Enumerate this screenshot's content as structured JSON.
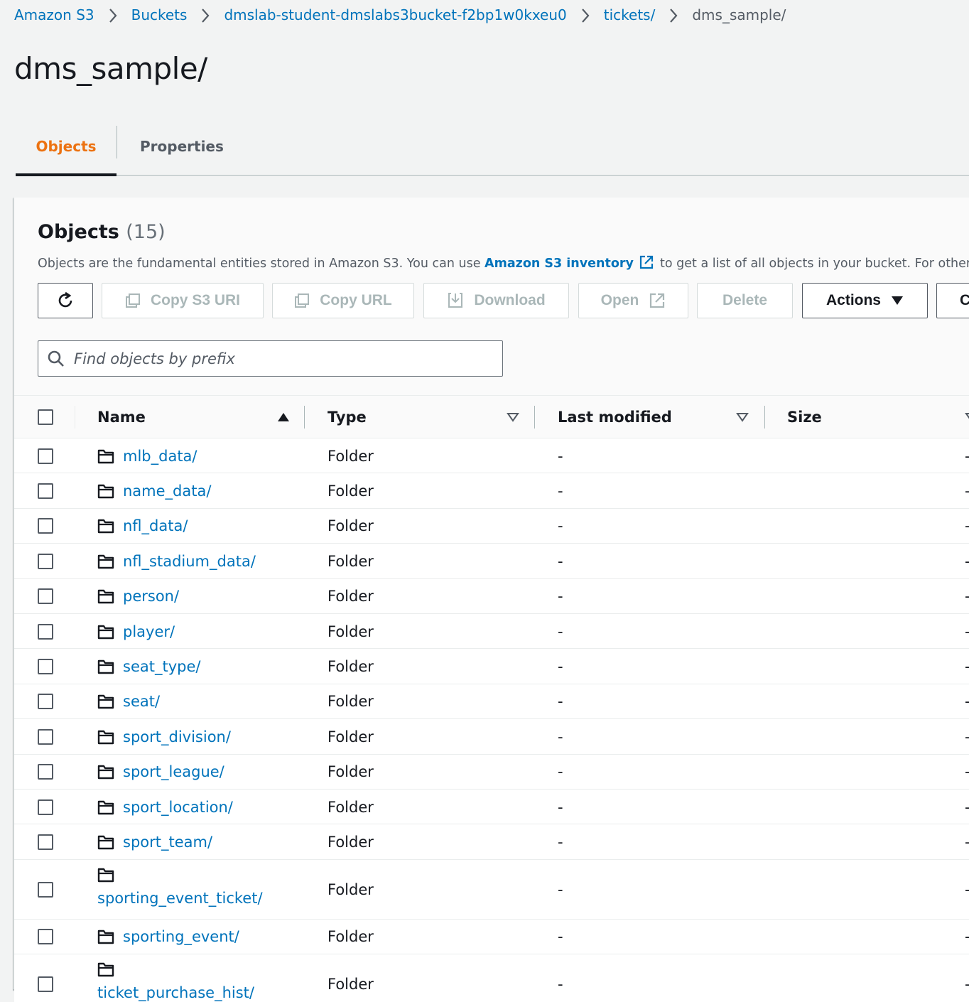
{
  "breadcrumb": [
    {
      "label": "Amazon S3"
    },
    {
      "label": "Buckets"
    },
    {
      "label": "dmslab-student-dmslabs3bucket-f2bp1w0kxeu0"
    },
    {
      "label": "tickets/"
    },
    {
      "label": "dms_sample/"
    }
  ],
  "page_title": "dms_sample/",
  "tabs": {
    "objects": "Objects",
    "properties": "Properties"
  },
  "panel": {
    "title": "Objects",
    "count": "(15)",
    "desc_before": "Objects are the fundamental entities stored in Amazon S3. You can use ",
    "desc_link": "Amazon S3 inventory",
    "desc_after": " to get a list of all objects in your bucket. For others to a"
  },
  "toolbar": {
    "copy_s3_uri": "Copy S3 URI",
    "copy_url": "Copy URL",
    "download": "Download",
    "open": "Open",
    "delete": "Delete",
    "actions": "Actions",
    "create_partial": "C"
  },
  "search": {
    "placeholder": "Find objects by prefix"
  },
  "table": {
    "columns": {
      "name": "Name",
      "type": "Type",
      "last_modified": "Last modified",
      "size": "Size"
    },
    "rows": [
      {
        "name": "mlb_data/",
        "type": "Folder",
        "last_modified": "-",
        "size": "-"
      },
      {
        "name": "name_data/",
        "type": "Folder",
        "last_modified": "-",
        "size": "-"
      },
      {
        "name": "nfl_data/",
        "type": "Folder",
        "last_modified": "-",
        "size": "-"
      },
      {
        "name": "nfl_stadium_data/",
        "type": "Folder",
        "last_modified": "-",
        "size": "-"
      },
      {
        "name": "person/",
        "type": "Folder",
        "last_modified": "-",
        "size": "-"
      },
      {
        "name": "player/",
        "type": "Folder",
        "last_modified": "-",
        "size": "-"
      },
      {
        "name": "seat_type/",
        "type": "Folder",
        "last_modified": "-",
        "size": "-"
      },
      {
        "name": "seat/",
        "type": "Folder",
        "last_modified": "-",
        "size": "-"
      },
      {
        "name": "sport_division/",
        "type": "Folder",
        "last_modified": "-",
        "size": "-"
      },
      {
        "name": "sport_league/",
        "type": "Folder",
        "last_modified": "-",
        "size": "-"
      },
      {
        "name": "sport_location/",
        "type": "Folder",
        "last_modified": "-",
        "size": "-"
      },
      {
        "name": "sport_team/",
        "type": "Folder",
        "last_modified": "-",
        "size": "-"
      },
      {
        "name": "sporting_event_ticket/",
        "type": "Folder",
        "last_modified": "-",
        "size": "-"
      },
      {
        "name": "sporting_event/",
        "type": "Folder",
        "last_modified": "-",
        "size": "-"
      },
      {
        "name": "ticket_purchase_hist/",
        "type": "Folder",
        "last_modified": "-",
        "size": "-"
      }
    ]
  },
  "colors": {
    "link": "#0073bb",
    "active_tab": "#ec7211",
    "text": "#16191f",
    "muted": "#545b64",
    "background": "#f2f3f3"
  }
}
